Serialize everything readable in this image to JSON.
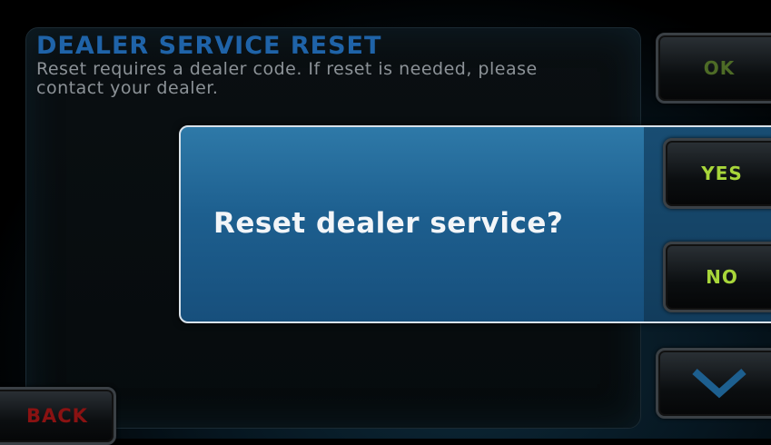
{
  "settings_screen": {
    "title": "DEALER SERVICE RESET",
    "description": "Reset requires a dealer code. If reset is needed, please contact your dealer.",
    "ok_label": "OK",
    "back_label": "BACK",
    "scroll_down_icon": "chevron-down-icon"
  },
  "dialog": {
    "question": "Reset dealer service?",
    "yes_label": "YES",
    "no_label": "NO"
  },
  "colors": {
    "title": "#1f63a8",
    "description": "#8c9297",
    "button_text_active": "#a8d63a",
    "back_text": "#8a1212",
    "dialog_bg": "#1d5f8f"
  }
}
